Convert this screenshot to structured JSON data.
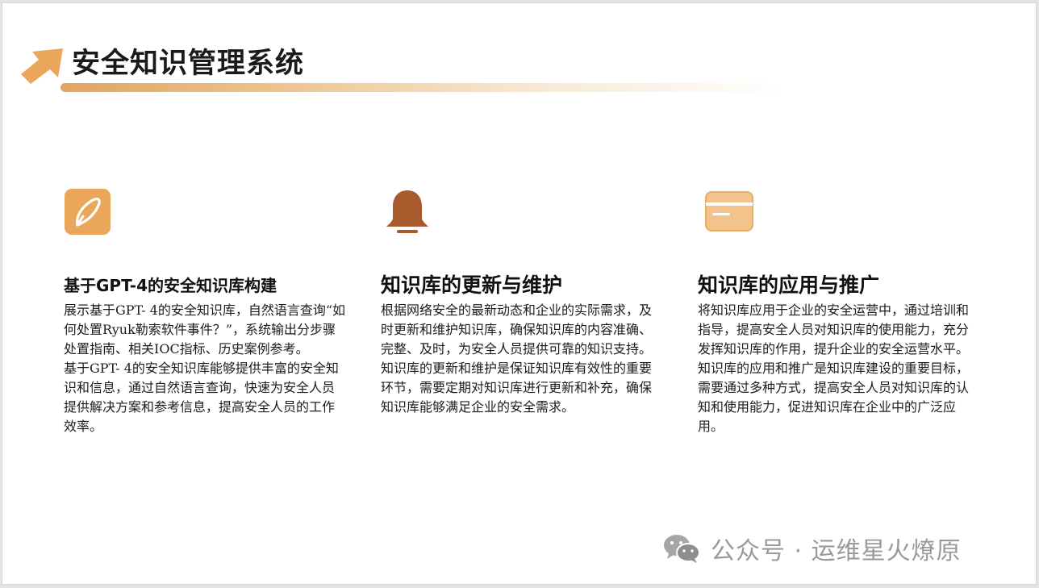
{
  "title": "安全知识管理系统",
  "columns": [
    {
      "icon": "pencil-icon",
      "heading": "基于GPT-4的安全知识库构建",
      "paragraphs": [
        "展示基于GPT- 4的安全知识库，自然语言查询“如何处置Ryuk勒索软件事件？”，系统输出分步骤处置指南、相关IOC指标、历史案例参考。",
        "基于GPT- 4的安全知识库能够提供丰富的安全知识和信息，通过自然语言查询，快速为安全人员提供解决方案和参考信息，提高安全人员的工作效率。"
      ]
    },
    {
      "icon": "bell-icon",
      "heading": "知识库的更新与维护",
      "paragraphs": [
        "根据网络安全的最新动态和企业的实际需求，及时更新和维护知识库，确保知识库的内容准确、完整、及时，为安全人员提供可靠的知识支持。",
        "知识库的更新和维护是保证知识库有效性的重要环节，需要定期对知识库进行更新和补充，确保知识库能够满足企业的安全需求。"
      ]
    },
    {
      "icon": "card-icon",
      "heading": "知识库的应用与推广",
      "paragraphs": [
        "将知识库应用于企业的安全运营中，通过培训和指导，提高安全人员对知识库的使用能力，充分发挥知识库的作用，提升企业的安全运营水平。",
        "知识库的应用和推广是知识库建设的重要目标，需要通过多种方式，提高安全人员对知识库的认知和使用能力，促进知识库在企业中的广泛应用。"
      ]
    }
  ],
  "watermark": "公众号 · 运维星火燎原",
  "colors": {
    "accent_orange": "#eaa65a",
    "accent_light": "#f2c38a",
    "bell_brown": "#a85a2c"
  }
}
